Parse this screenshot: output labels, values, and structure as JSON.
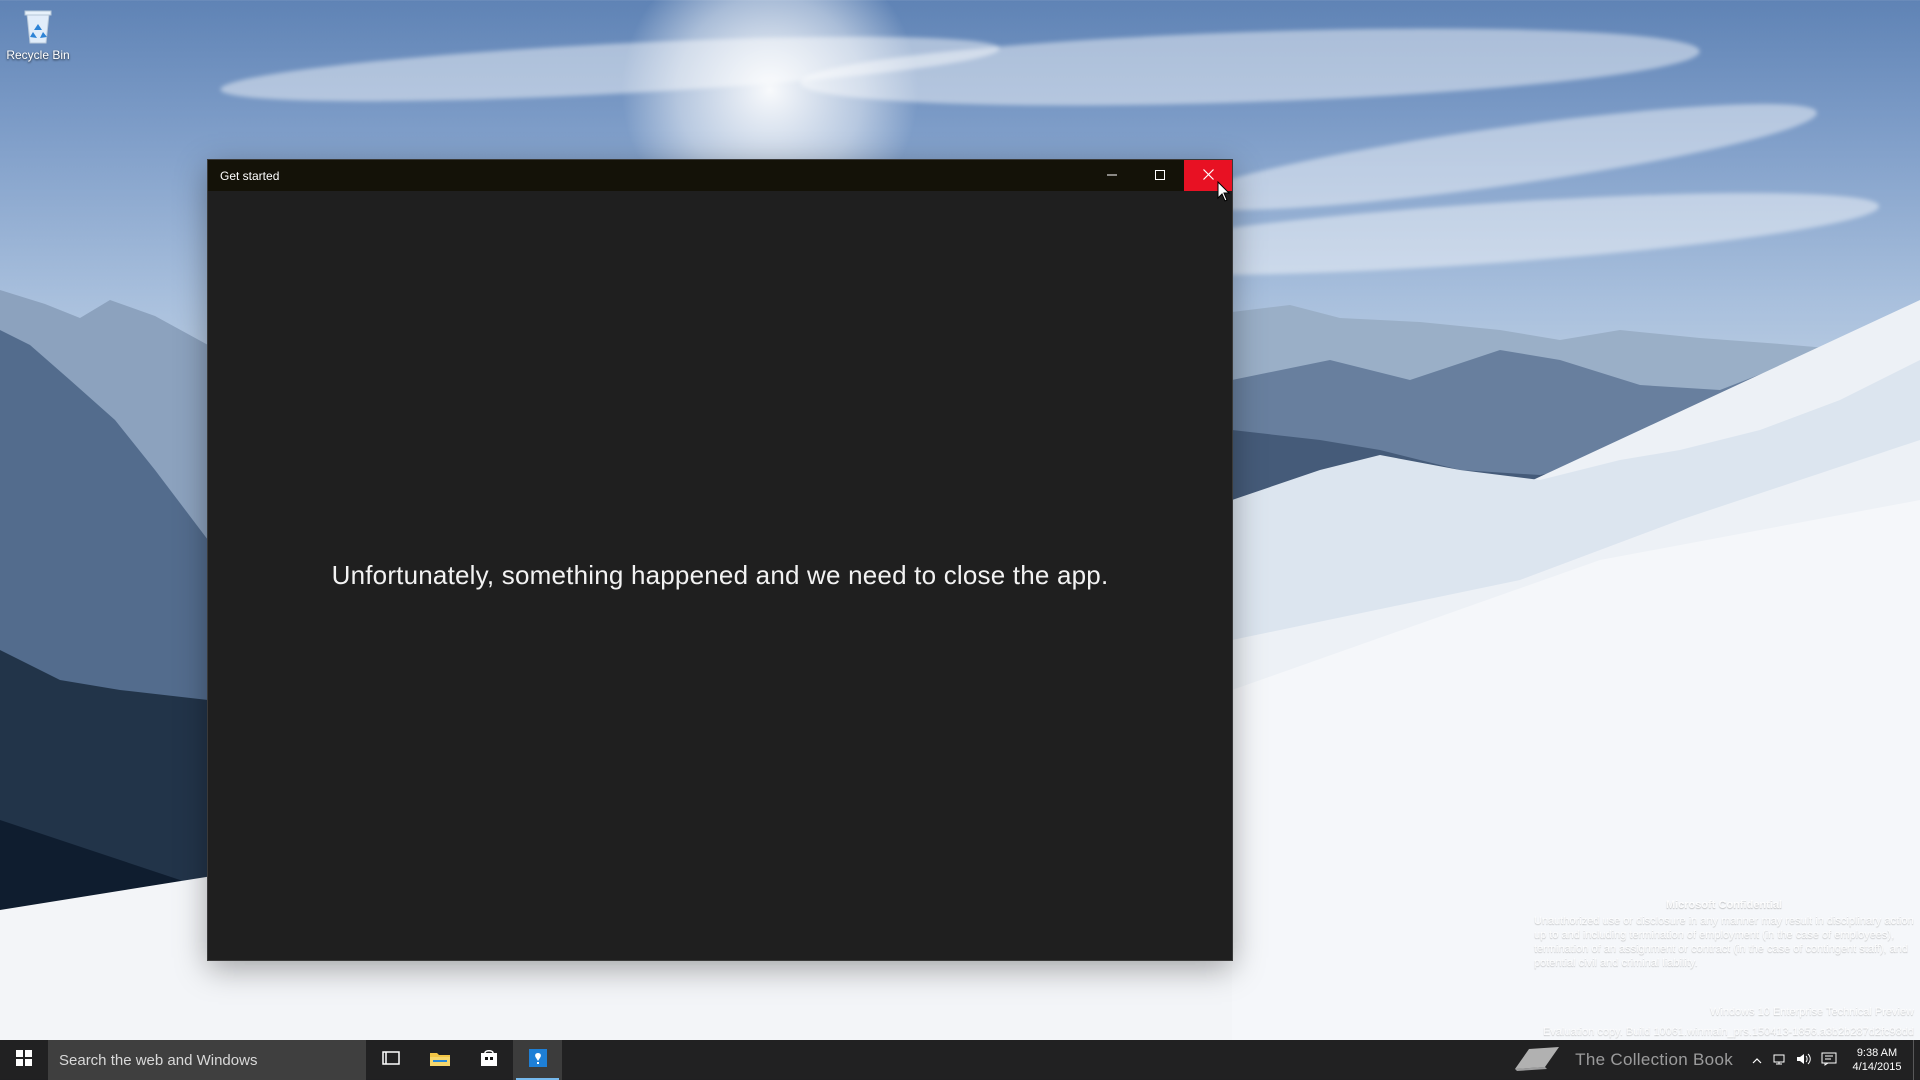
{
  "desktop": {
    "icons": [
      {
        "label": "Recycle Bin",
        "icon": "recycle-bin-icon"
      }
    ],
    "watermark": {
      "heading": "Microsoft Confidential",
      "text": "Unauthorized use or disclosure in any manner may result in disciplinary action up to and including termination of employment (in the case of employees), termination of an assignment or contract (in the case of contingent staff), and potential civil and criminal liability.",
      "edition": "Windows 10 Enterprise Technical Preview",
      "build": "Evaluation copy. Build 10061.winmain_prs.150413-1856.a3b2b287d2fc98dd"
    },
    "colors": {
      "sky_top": "#5f83b5",
      "snow": "#eef2f6",
      "forest": "#21324a"
    }
  },
  "window": {
    "title": "Get started",
    "message": "Unfortunately, something happened and we need to close the app.",
    "controls": {
      "minimize": "minimize-icon",
      "maximize": "maximize-icon",
      "close": "close-icon"
    },
    "colors": {
      "title_bar": "#141208",
      "content_bg": "#1f1f1f",
      "close_hover": "#e81123"
    }
  },
  "taskbar": {
    "search_placeholder": "Search the web and Windows",
    "pinned": [
      {
        "name": "task-view-icon"
      },
      {
        "name": "file-explorer-icon"
      },
      {
        "name": "store-icon"
      },
      {
        "name": "get-started-icon",
        "active": true
      }
    ],
    "tray": {
      "branding": "The Collection Book",
      "time": "9:38 AM",
      "date": "4/14/2015",
      "icons": [
        "chevron-up-icon",
        "network-icon",
        "volume-icon",
        "action-center-icon"
      ]
    },
    "colors": {
      "background": "#0f0f0f",
      "active_indicator": "#76b9ed",
      "search_bg": "#3f3f3f"
    }
  }
}
